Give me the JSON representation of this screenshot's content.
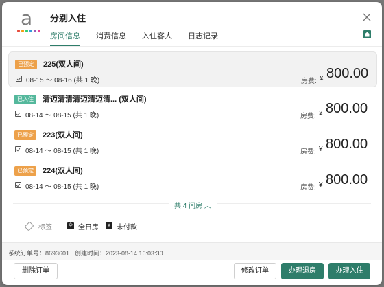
{
  "header": {
    "title": "分别入住",
    "logo_letter": "a",
    "logo_dot_colors": [
      "#e74c3c",
      "#f39c12",
      "#2ecc71",
      "#3498db",
      "#9b59b6",
      "#e84393"
    ]
  },
  "tabs": [
    {
      "label": "房间信息",
      "active": true
    },
    {
      "label": "消费信息",
      "active": false
    },
    {
      "label": "入住客人",
      "active": false
    },
    {
      "label": "日志记录",
      "active": false
    }
  ],
  "rooms": [
    {
      "status": "已预定",
      "name": "225(双人间)",
      "dates": "08-15 ～ 08-16 (共 1 晚)",
      "fee_label": "房费:",
      "currency": "¥",
      "amount": "800.00",
      "selected": true
    },
    {
      "status": "已入住",
      "name": "清迈清清清迈清迈清... (双人间)",
      "dates": "08-14 ～ 08-15 (共 1 晚)",
      "fee_label": "房费:",
      "currency": "¥",
      "amount": "800.00",
      "selected": false
    },
    {
      "status": "已预定",
      "name": "223(双人间)",
      "dates": "08-14 ～ 08-15 (共 1 晚)",
      "fee_label": "房费:",
      "currency": "¥",
      "amount": "800.00",
      "selected": false
    },
    {
      "status": "已预定",
      "name": "224(双人间)",
      "dates": "08-14 ～ 08-15 (共 1 晚)",
      "fee_label": "房费:",
      "currency": "¥",
      "amount": "800.00",
      "selected": false
    }
  ],
  "total_rooms": "共 4 间房 ︿",
  "tags": {
    "label": "标签",
    "chips": [
      {
        "icon": "全",
        "label": "全日房"
      },
      {
        "icon": "¥",
        "label": "未付款"
      }
    ]
  },
  "footer": {
    "order_no": "系统订单号：8693601",
    "created": "创建时间：2023-08-14 16:03:30"
  },
  "buttons": {
    "delete": "删除订单",
    "modify": "修改订单",
    "checkout": "办理退房",
    "checkin": "办理入住"
  },
  "colors": {
    "accent": "#2e7d6a",
    "booked": "#eda14a",
    "checked_in": "#54b89c"
  }
}
